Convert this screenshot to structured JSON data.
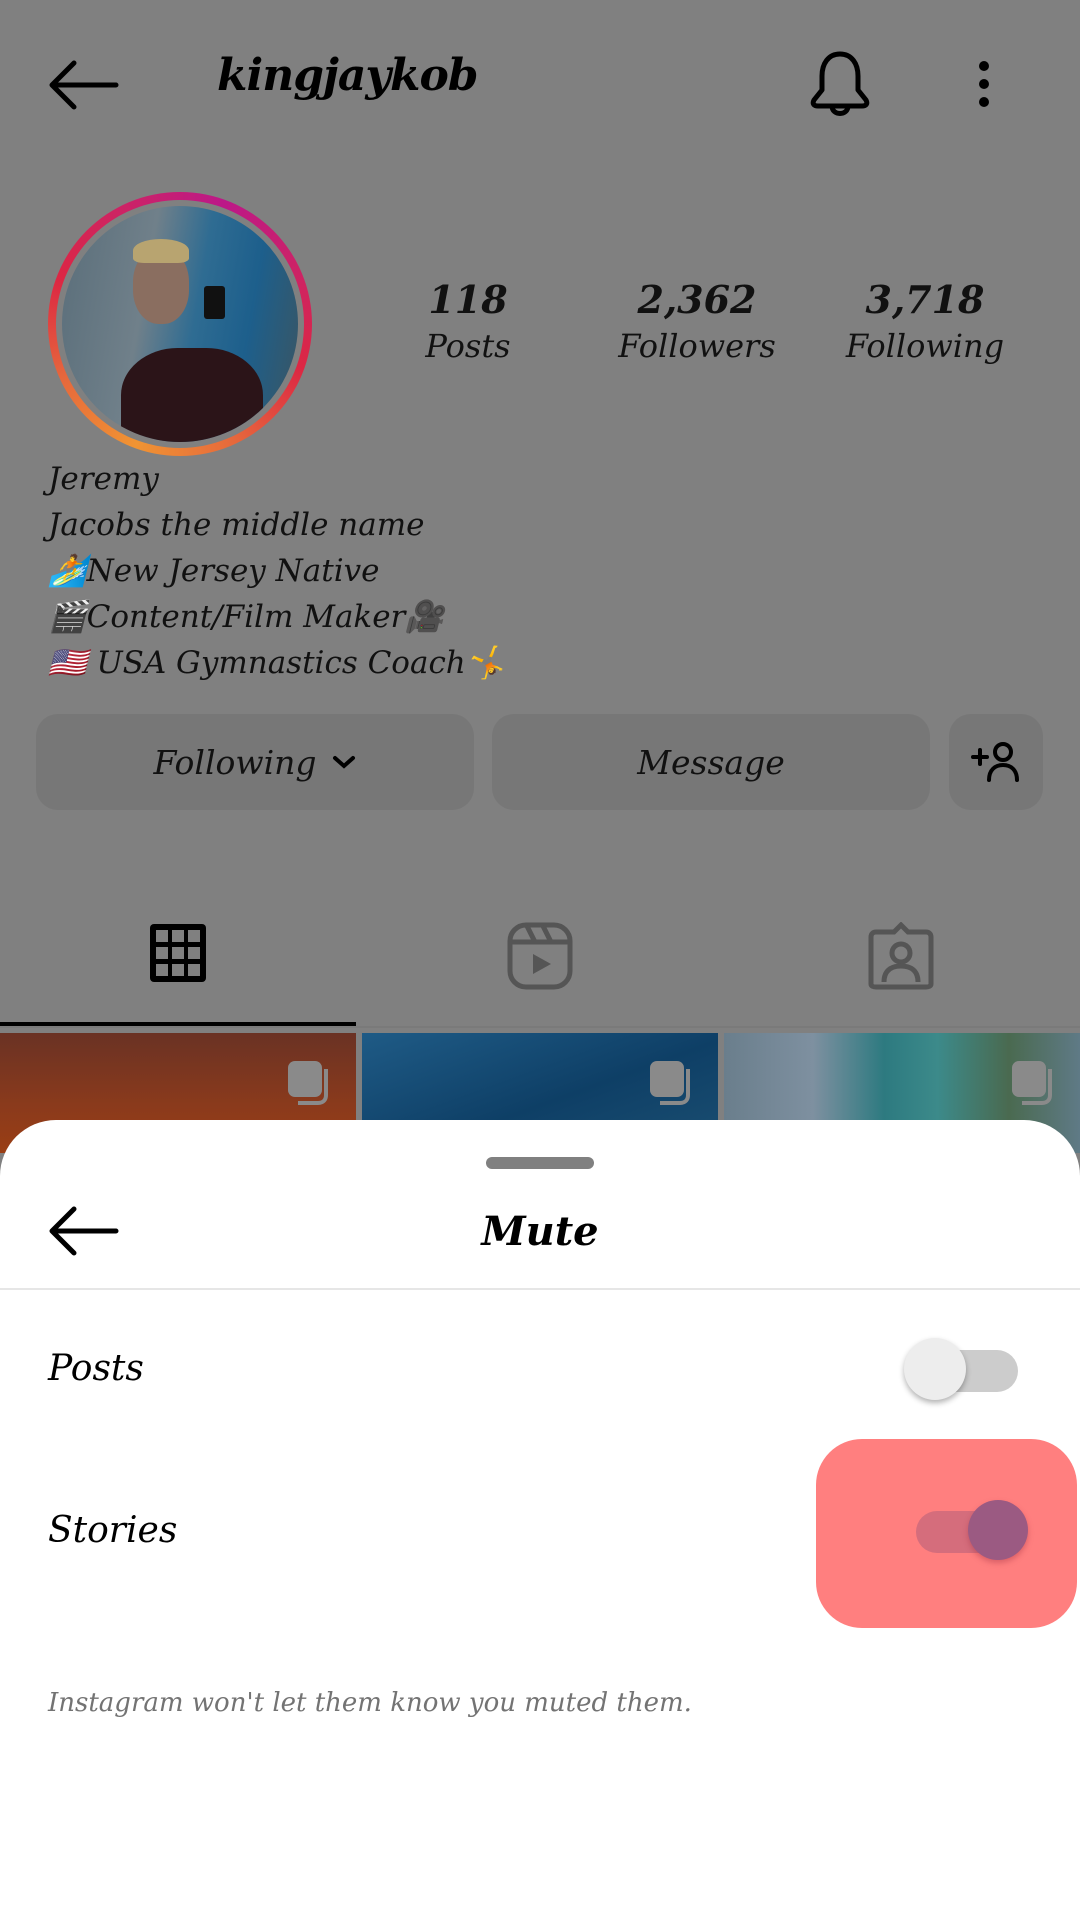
{
  "profile": {
    "username": "kingjaykob",
    "icons": {
      "back": "back-arrow-icon",
      "notifications": "bell-icon",
      "more": "more-vertical-icon"
    },
    "stats": [
      {
        "value": "118",
        "label": "Posts"
      },
      {
        "value": "2,362",
        "label": "Followers"
      },
      {
        "value": "3,718",
        "label": "Following"
      }
    ],
    "bio": [
      "Jeremy",
      "Jacobs the middle name",
      "🏄New Jersey Native",
      "🎬Content/Film Maker🎥",
      "🇺🇸 USA Gymnastics Coach🤸"
    ],
    "buttons": {
      "following": "Following",
      "following_chevron": "⌄",
      "message": "Message"
    },
    "tabs": [
      {
        "name": "posts-grid",
        "active": true
      },
      {
        "name": "reels",
        "active": false
      },
      {
        "name": "tagged",
        "active": false
      }
    ],
    "story_ring_colors": [
      "#f09433",
      "#dc2743",
      "#bc1888"
    ]
  },
  "sheet": {
    "title": "Mute",
    "options": [
      {
        "label": "Posts",
        "enabled": false
      },
      {
        "label": "Stories",
        "enabled": true
      }
    ],
    "note": "Instagram won't let them know you muted them.",
    "highlight_color": "#ff7f7f"
  }
}
